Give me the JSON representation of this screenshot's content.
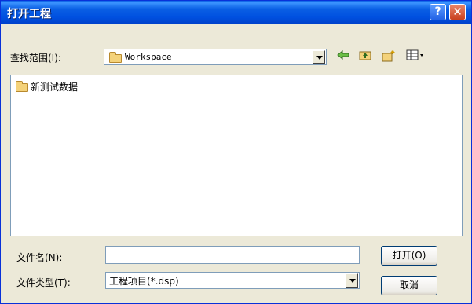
{
  "window": {
    "title": "打开工程"
  },
  "look_in": {
    "label": "查找范围(I):",
    "value": "Workspace",
    "folder_icon": "folder-icon"
  },
  "toolbar": {
    "back_icon": "back-arrow-icon",
    "up_icon": "up-folder-icon",
    "new_folder_icon": "new-folder-icon",
    "views_icon": "view-menu-icon"
  },
  "file_list": {
    "items": [
      {
        "label": "新测试数据",
        "icon": "folder-icon"
      }
    ]
  },
  "filename": {
    "label": "文件名(N):",
    "value": ""
  },
  "filetype": {
    "label": "文件类型(T):",
    "value": "工程项目(*.dsp)"
  },
  "buttons": {
    "open": "打开(O)",
    "cancel": "取消"
  }
}
